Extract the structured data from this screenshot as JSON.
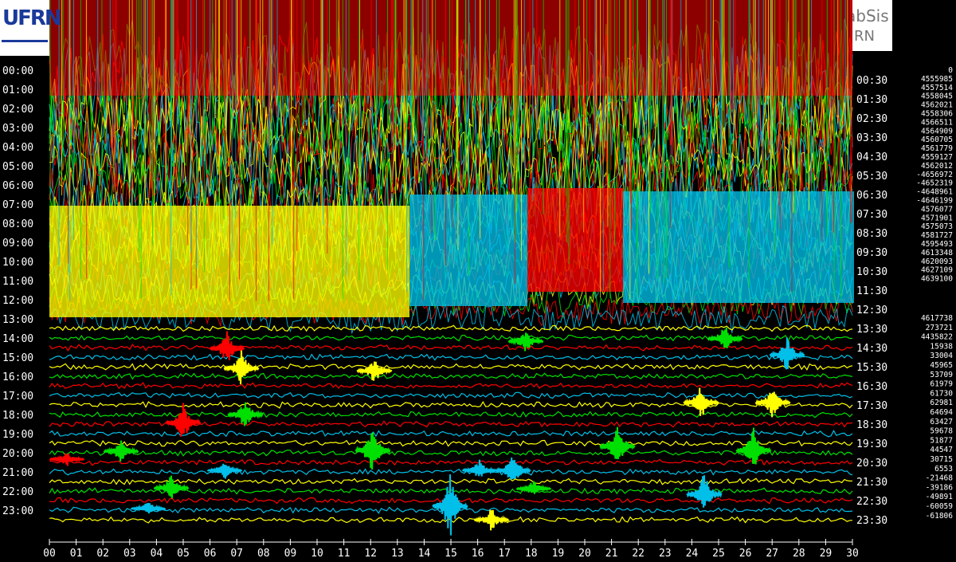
{
  "chart_data": {
    "type": "line",
    "title": "",
    "xlabel": "",
    "ylabel": "",
    "x_ticks": [
      "00",
      "01",
      "02",
      "03",
      "04",
      "05",
      "06",
      "07",
      "08",
      "09",
      "10",
      "11",
      "12",
      "13",
      "14",
      "15",
      "16",
      "17",
      "18",
      "19",
      "20",
      "21",
      "22",
      "23",
      "24",
      "25",
      "26",
      "27",
      "28",
      "29",
      "30"
    ],
    "xlim": [
      0,
      30
    ],
    "left_labels": [
      "00:00",
      "01:00",
      "02:00",
      "03:00",
      "04:00",
      "05:00",
      "06:00",
      "07:00",
      "08:00",
      "09:00",
      "10:00",
      "11:00",
      "12:00",
      "13:00",
      "14:00",
      "15:00",
      "16:00",
      "17:00",
      "18:00",
      "19:00",
      "20:00",
      "21:00",
      "22:00",
      "23:00"
    ],
    "right_labels": [
      "00:30",
      "01:30",
      "02:30",
      "03:30",
      "04:30",
      "05:30",
      "06:30",
      "07:30",
      "08:30",
      "09:30",
      "10:30",
      "11:30",
      "12:30",
      "13:30",
      "14:30",
      "15:30",
      "16:30",
      "17:30",
      "18:30",
      "19:30",
      "20:30",
      "21:30",
      "22:30",
      "23:30"
    ],
    "trace_colors": [
      "#00e000",
      "#ff0000",
      "#00bfe8",
      "#ffff00"
    ],
    "series": [
      {
        "values": [
          "0",
          "4555985",
          "4557514",
          "4558045",
          "4562021",
          "4558306",
          "4566511",
          "4564909",
          "4560705",
          "4561779",
          "4559127",
          "4562012",
          "-4656972",
          "-4652319",
          "-4648961",
          "-4646199",
          "4576077",
          "4571901",
          "4575073",
          "4581727",
          "4595493",
          "4613348",
          "4620093",
          "4627109",
          "4639100"
        ]
      },
      {
        "values": [
          "4617738",
          "273721",
          "4435822",
          "15938",
          "33004",
          "45965",
          "53709",
          "61979",
          "61730",
          "62981",
          "64694",
          "63427",
          "59678",
          "51877",
          "44547",
          "30715",
          "6553",
          "-21468",
          "-39186",
          "-49891",
          "-60059",
          "-61806"
        ]
      }
    ]
  },
  "logos": {
    "left_text": "UFRN",
    "right_line1": "abSis",
    "right_line2": "RN"
  }
}
